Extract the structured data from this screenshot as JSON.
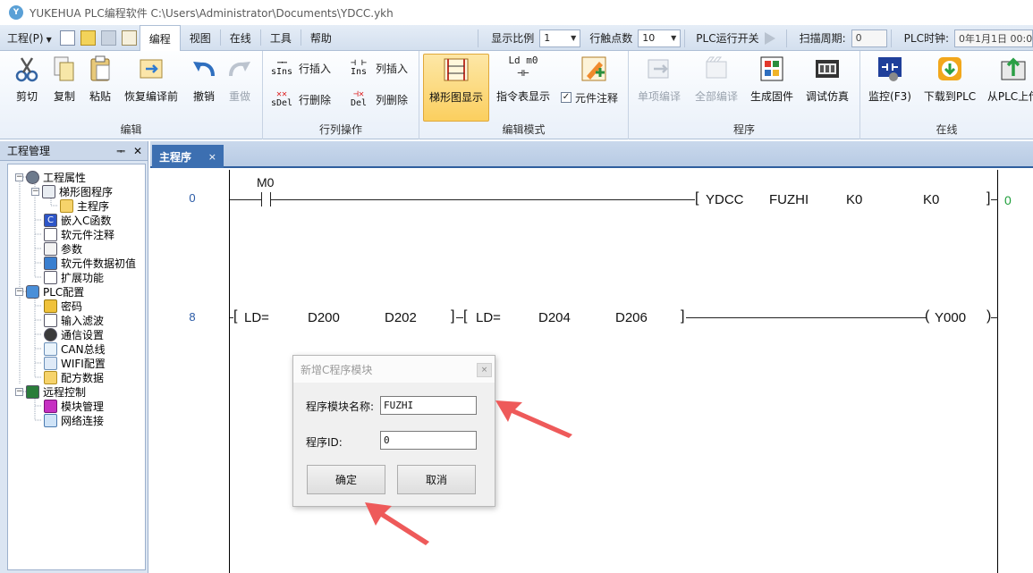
{
  "window": {
    "title": "YUKEHUA PLC编程软件 C:\\Users\\Administrator\\Documents\\YDCC.ykh",
    "logo_text": "Y"
  },
  "menu": {
    "project_label": "工程(P)",
    "tabs": [
      "编程",
      "视图",
      "在线",
      "工具",
      "帮助"
    ],
    "active_tab": "编程"
  },
  "toolbar_settings": {
    "display_ratio_label": "显示比例",
    "display_ratio_value": "1",
    "row_contacts_label": "行触点数",
    "row_contacts_value": "10",
    "plc_run_switch_label": "PLC运行开关",
    "scan_cycle_label": "扫描周期:",
    "scan_cycle_value": "0",
    "plc_clock_label": "PLC时钟:",
    "plc_clock_value": "0年1月1日 00:0"
  },
  "ribbon": {
    "groups": [
      {
        "label": "编辑",
        "buttons": [
          "剪切",
          "复制",
          "粘贴",
          "恢复编译前",
          "撤销",
          "重做"
        ]
      },
      {
        "label": "行列操作",
        "buttons": [
          "行插入",
          "行删除",
          "列插入",
          "列删除"
        ]
      },
      {
        "label": "编辑模式",
        "buttons": [
          "梯形图显示",
          "指令表显示",
          "元件注释"
        ]
      },
      {
        "label": "程序",
        "buttons": [
          "单项编译",
          "全部编译",
          "生成固件",
          "调试仿真"
        ]
      },
      {
        "label": "在线",
        "buttons": [
          "监控(F3)",
          "下载到PLC",
          "从PLC上传"
        ]
      }
    ],
    "small_icon_codes": {
      "row_insert": "sIns",
      "row_delete": "sDel",
      "col_insert": "Ins",
      "col_delete": "Del",
      "instr_list": "Ld m0"
    },
    "element_comment_checked": true
  },
  "project_panel": {
    "title": "工程管理",
    "pin_glyph": "ᆍ",
    "close_glyph": "✕",
    "tree": [
      {
        "label": "工程属性",
        "level": 0
      },
      {
        "label": "梯形图程序",
        "level": 1
      },
      {
        "label": "主程序",
        "level": 2
      },
      {
        "label": "嵌入C函数",
        "level": 1
      },
      {
        "label": "软元件注释",
        "level": 1
      },
      {
        "label": "参数",
        "level": 1
      },
      {
        "label": "软元件数据初值",
        "level": 1
      },
      {
        "label": "扩展功能",
        "level": 1
      },
      {
        "label": "PLC配置",
        "level": 0
      },
      {
        "label": "密码",
        "level": 1
      },
      {
        "label": "输入滤波",
        "level": 1
      },
      {
        "label": "通信设置",
        "level": 1
      },
      {
        "label": "CAN总线",
        "level": 1
      },
      {
        "label": "WIFI配置",
        "level": 1
      },
      {
        "label": "配方数据",
        "level": 1
      },
      {
        "label": "远程控制",
        "level": 0
      },
      {
        "label": "模块管理",
        "level": 1
      },
      {
        "label": "网络连接",
        "level": 1
      }
    ]
  },
  "editor": {
    "tab_label": "主程序",
    "tab_close": "×",
    "rungs": [
      {
        "step": "0",
        "contact_label": "M0",
        "instruction": [
          "YDCC",
          "FUZHI",
          "K0",
          "K0"
        ],
        "result": "0"
      },
      {
        "step": "8",
        "compare1": [
          "LD=",
          "D200",
          "D202"
        ],
        "compare2": [
          "LD=",
          "D204",
          "D206"
        ],
        "coil": "Y000"
      }
    ]
  },
  "dialog": {
    "title": "新增C程序模块",
    "name_label": "程序模块名称:",
    "name_value": "FUZHI",
    "id_label": "程序ID:",
    "id_value": "0",
    "ok_label": "确定",
    "cancel_label": "取消",
    "close_glyph": "×"
  },
  "colors": {
    "accent_tab": "#3c6fb1",
    "annotation_arrow": "#ee5a5a",
    "result_green": "#1e9e3a",
    "step_blue": "#2a5aa6"
  }
}
